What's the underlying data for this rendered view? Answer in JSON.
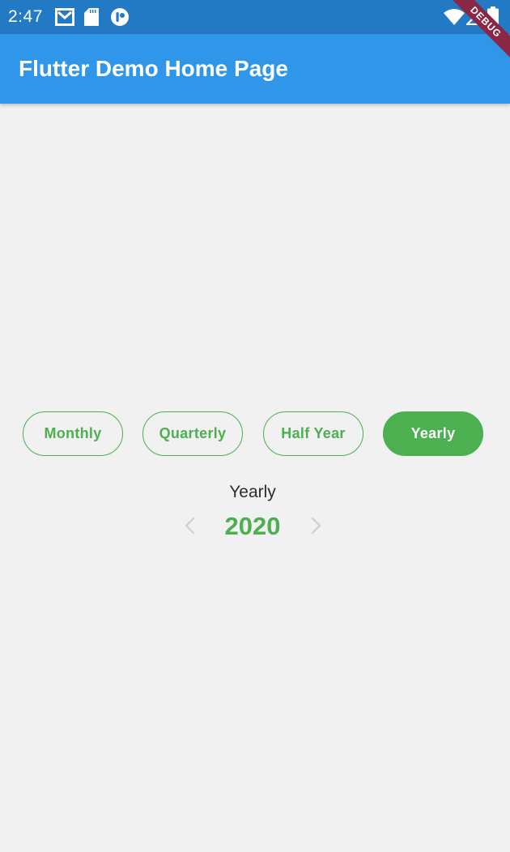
{
  "status_bar": {
    "time": "2:47",
    "icons": [
      "gmail-icon",
      "sd-card-icon",
      "notification-app-icon",
      "wifi-icon",
      "signal-icon",
      "battery-icon"
    ]
  },
  "app_bar": {
    "title": "Flutter Demo Home Page"
  },
  "debug_banner": {
    "label": "DEBUG"
  },
  "period_selector": {
    "options": [
      {
        "label": "Monthly",
        "selected": false
      },
      {
        "label": "Quarterly",
        "selected": false
      },
      {
        "label": "Half Year",
        "selected": false
      },
      {
        "label": "Yearly",
        "selected": true
      }
    ]
  },
  "period_display": {
    "label": "Yearly",
    "value": "2020",
    "prev_icon": "chevron-left-icon",
    "next_icon": "chevron-right-icon"
  },
  "colors": {
    "status_bar": "#2279c4",
    "app_bar": "#2f96ea",
    "accent_green": "#4caf50",
    "background": "#f1f1f1",
    "debug_ribbon": "#8a2744",
    "chevron_disabled": "#cfcfcf"
  }
}
